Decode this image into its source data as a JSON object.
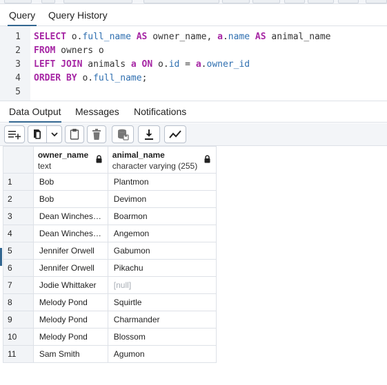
{
  "query_tabs": [
    {
      "label": "Query",
      "active": true
    },
    {
      "label": "Query History",
      "active": false
    }
  ],
  "editor": {
    "lines": [
      {
        "n": "1",
        "tokens": [
          {
            "t": "SELECT",
            "c": "kw"
          },
          {
            "t": " o.",
            "c": "idn"
          },
          {
            "t": "full_name",
            "c": "prop"
          },
          {
            "t": " AS",
            "c": "kw"
          },
          {
            "t": " owner_name, ",
            "c": "idn"
          },
          {
            "t": "a",
            "c": "kw"
          },
          {
            "t": ".",
            "c": "idn"
          },
          {
            "t": "name",
            "c": "prop"
          },
          {
            "t": " AS",
            "c": "kw"
          },
          {
            "t": " animal_name",
            "c": "idn"
          }
        ]
      },
      {
        "n": "2",
        "tokens": [
          {
            "t": "FROM",
            "c": "kw"
          },
          {
            "t": " owners o",
            "c": "idn"
          }
        ]
      },
      {
        "n": "3",
        "tokens": [
          {
            "t": "LEFT JOIN",
            "c": "kw"
          },
          {
            "t": " animals ",
            "c": "idn"
          },
          {
            "t": "a",
            "c": "kw"
          },
          {
            "t": " ON",
            "c": "kw"
          },
          {
            "t": " o.",
            "c": "idn"
          },
          {
            "t": "id",
            "c": "prop"
          },
          {
            "t": " = ",
            "c": "idn"
          },
          {
            "t": "a",
            "c": "kw"
          },
          {
            "t": ".",
            "c": "idn"
          },
          {
            "t": "owner_id",
            "c": "prop"
          }
        ]
      },
      {
        "n": "4",
        "tokens": [
          {
            "t": "ORDER BY",
            "c": "kw"
          },
          {
            "t": " o.",
            "c": "idn"
          },
          {
            "t": "full_name",
            "c": "prop"
          },
          {
            "t": ";",
            "c": "idn"
          }
        ]
      },
      {
        "n": "5",
        "tokens": []
      }
    ]
  },
  "output_tabs": [
    {
      "label": "Data Output",
      "active": true
    },
    {
      "label": "Messages",
      "active": false
    },
    {
      "label": "Notifications",
      "active": false
    }
  ],
  "toolbar": {
    "icons": [
      "add-row-icon",
      "copy-icon",
      "chevron-down-icon",
      "paste-icon",
      "delete-icon",
      "save-data-icon",
      "download-icon",
      "graph-icon"
    ]
  },
  "grid": {
    "columns": [
      {
        "name": "owner_name",
        "type": "text"
      },
      {
        "name": "animal_name",
        "type": "character varying (255)"
      }
    ],
    "rows": [
      {
        "n": "1",
        "owner": "Bob",
        "animal": "Plantmon"
      },
      {
        "n": "2",
        "owner": "Bob",
        "animal": "Devimon"
      },
      {
        "n": "3",
        "owner": "Dean Winchester",
        "animal": "Boarmon"
      },
      {
        "n": "4",
        "owner": "Dean Winchester",
        "animal": "Angemon"
      },
      {
        "n": "5",
        "owner": "Jennifer Orwell",
        "animal": "Gabumon"
      },
      {
        "n": "6",
        "owner": "Jennifer Orwell",
        "animal": "Pikachu"
      },
      {
        "n": "7",
        "owner": "Jodie Whittaker",
        "animal": "[null]"
      },
      {
        "n": "8",
        "owner": "Melody Pond",
        "animal": "Squirtle"
      },
      {
        "n": "9",
        "owner": "Melody Pond",
        "animal": "Charmander"
      },
      {
        "n": "10",
        "owner": "Melody Pond",
        "animal": "Blossom"
      },
      {
        "n": "11",
        "owner": "Sam Smith",
        "animal": "Agumon"
      }
    ]
  }
}
